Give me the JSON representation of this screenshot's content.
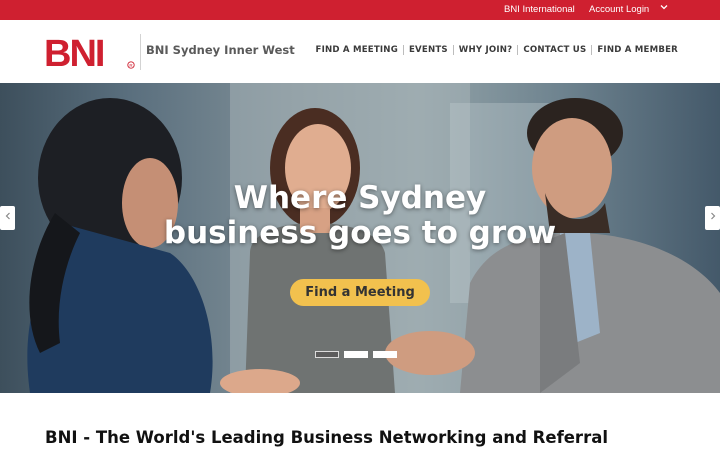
{
  "topbar": {
    "links": [
      "BNI International",
      "Account Login"
    ],
    "dropdown_icon": "chevron-down-icon",
    "color": "#cf2030"
  },
  "header": {
    "logo_text": "BNI",
    "logo_mark": "®",
    "chapter_name": "BNI Sydney Inner West",
    "nav": [
      "FIND A MEETING",
      "EVENTS",
      "WHY JOIN?",
      "CONTACT US",
      "FIND A MEMBER"
    ]
  },
  "hero": {
    "headline_line1": "Where Sydney",
    "headline_line2": "business goes to grow",
    "cta_label": "Find a Meeting",
    "cta_color": "#f2c14e",
    "prev_icon": "chevron-left-icon",
    "next_icon": "chevron-right-icon",
    "slide_count": 3,
    "active_slide": 1
  },
  "section": {
    "title": "BNI - The World's Leading Business Networking and Referral"
  }
}
